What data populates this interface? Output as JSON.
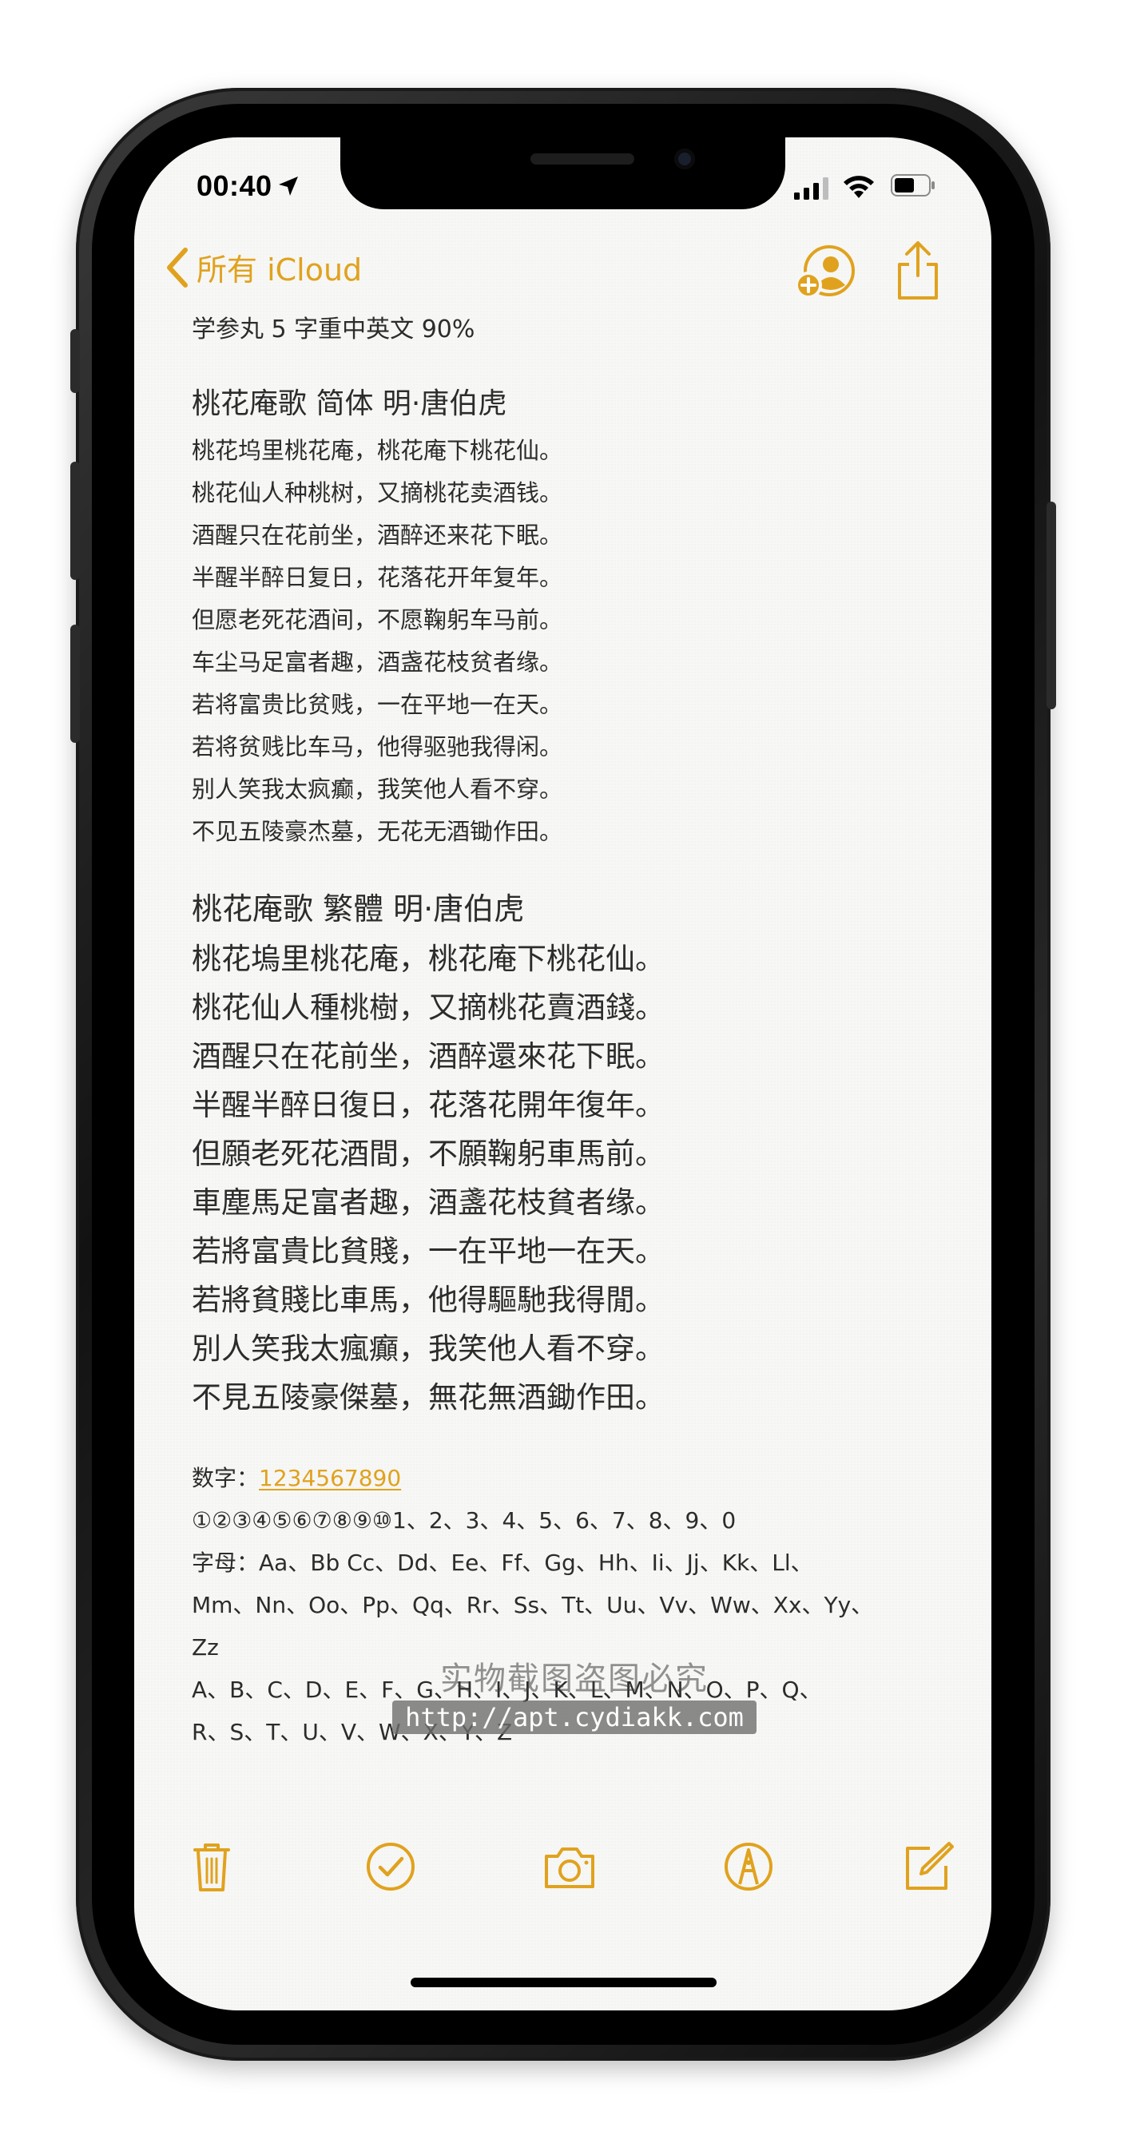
{
  "status": {
    "time": "00:40"
  },
  "nav": {
    "back_label": "所有 iCloud"
  },
  "note": {
    "title": "学参丸 5 字重中英文 90%",
    "simplified": {
      "heading": "桃花庵歌 简体  明·唐伯虎",
      "lines": [
        "桃花坞里桃花庵，桃花庵下桃花仙。",
        "桃花仙人种桃树，又摘桃花卖酒钱。",
        "酒醒只在花前坐，酒醉还来花下眠。",
        "半醒半醉日复日，花落花开年复年。",
        "但愿老死花酒间，不愿鞠躬车马前。",
        "车尘马足富者趣，酒盏花枝贫者缘。",
        "若将富贵比贫贱，一在平地一在天。",
        "若将贫贱比车马，他得驱驰我得闲。",
        "别人笑我太疯癫，我笑他人看不穿。",
        "不见五陵豪杰墓，无花无酒锄作田。"
      ]
    },
    "traditional": {
      "heading": "桃花庵歌 繁體    明·唐伯虎",
      "lines": [
        "桃花塢里桃花庵，桃花庵下桃花仙。",
        "桃花仙人種桃樹，又摘桃花賣酒錢。",
        "酒醒只在花前坐，酒醉還來花下眠。",
        "半醒半醉日復日，花落花開年復年。",
        "但願老死花酒間，不願鞠躬車馬前。",
        "車塵馬足富者趣，酒盞花枝貧者缘。",
        "若將富貴比貧賤，一在平地一在天。",
        "若將貧賤比車馬，他得驅馳我得閒。",
        "別人笑我太瘋癲，我笑他人看不穿。",
        "不見五陵豪傑墓，無花無酒鋤作田。"
      ]
    },
    "numbers": {
      "label": "数字：",
      "link": "1234567890",
      "circled": "①②③④⑤⑥⑦⑧⑨⑩1、2、3、4、5、6、7、8、9、0"
    },
    "letters": {
      "line1": "字母：Aa、Bb Cc、Dd、Ee、Ff、Gg、Hh、Ii、Jj、Kk、Ll、",
      "line2": "Mm、Nn、Oo、Pp、Qq、Rr、Ss、Tt、Uu、Vv、Ww、Xx、Yy、",
      "line3": "Zz",
      "line4": "A、B、C、D、E、F、G、H、I、J、K、L、M、N、O、P、Q、",
      "line5": "R、S、T、U、V、W、X、Y、Z"
    }
  },
  "watermark": {
    "text": "实物截图盗图必究",
    "url": "http://apt.cydiakk.com"
  },
  "toolbar": {
    "icons": [
      "trash-icon",
      "checklist-icon",
      "camera-icon",
      "markup-icon",
      "compose-icon"
    ]
  },
  "colors": {
    "accent": "#e0a21e",
    "text": "#2c2c2c",
    "paper": "#f7f7f5"
  }
}
